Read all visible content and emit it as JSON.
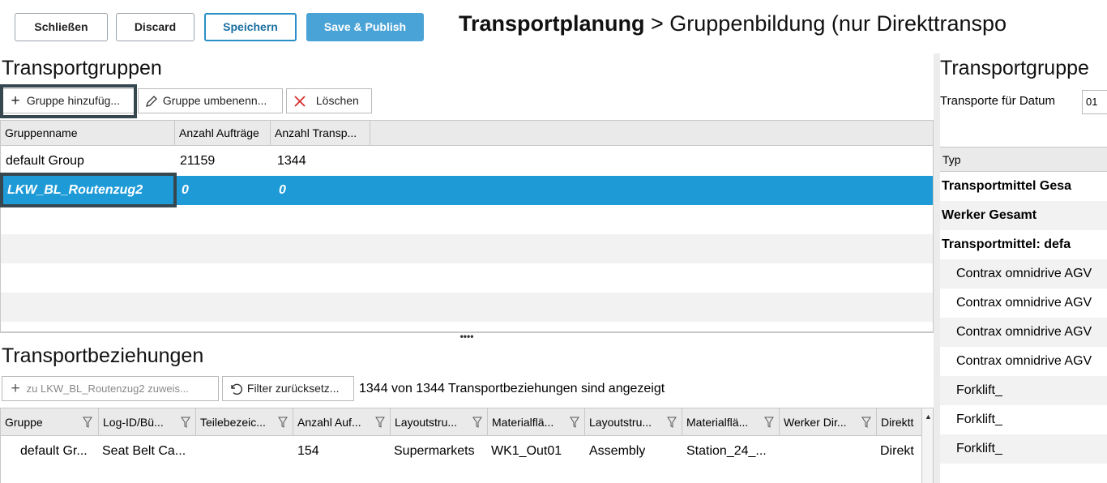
{
  "toolbar": {
    "close_label": "Schließen",
    "discard_label": "Discard",
    "save_label": "Speichern",
    "publish_label": "Save & Publish"
  },
  "page_title": {
    "part1": "Transportplanung",
    "sep": " > ",
    "part2": "Gruppenbildung (nur Direkttranspo"
  },
  "groups": {
    "title": "Transportgruppen",
    "add_label": "Gruppe hinzufüg...",
    "rename_label": "Gruppe umbenenn...",
    "delete_label": "Löschen",
    "columns": [
      "Gruppenname",
      "Anzahl Aufträge",
      "Anzahl Transp..."
    ],
    "rows": [
      {
        "name": "default Group",
        "orders": "21159",
        "transports": "1344"
      },
      {
        "name": "LKW_BL_Routenzug2",
        "orders": "0",
        "transports": "0"
      }
    ],
    "splitter_label": "••••"
  },
  "relations": {
    "title": "Transportbeziehungen",
    "assign_label": "zu LKW_BL_Routenzug2 zuweis...",
    "reset_label": "Filter zurücksetz...",
    "status_text": "1344 von 1344 Transportbeziehungen sind angezeigt",
    "columns": [
      "Gruppe",
      "Log-ID/Bü...",
      "Teilebezeic...",
      "Anzahl Auf...",
      "Layoutstru...",
      "Materialflä...",
      "Layoutstru...",
      "Materialflä...",
      "Werker Dir...",
      "Direktt"
    ],
    "rows": [
      [
        "default Gr...",
        "Seat Belt Ca...",
        "",
        "154",
        "Supermarkets",
        "WK1_Out01",
        "Assembly",
        "Station_24_...",
        "",
        "Direkt"
      ]
    ]
  },
  "right_panel": {
    "title": "Transportgruppe",
    "date_label": "Transporte für Datum",
    "date_value": "01",
    "column_label": "Typ",
    "rows": [
      {
        "label": "Transportmittel Gesa",
        "style": "bold"
      },
      {
        "label": "Werker Gesamt",
        "style": "bold"
      },
      {
        "label": "Transportmittel: defa",
        "style": "bold"
      },
      {
        "label": "Contrax omnidrive AGV",
        "style": "indent"
      },
      {
        "label": "Contrax omnidrive AGV",
        "style": "indent"
      },
      {
        "label": "Contrax omnidrive AGV",
        "style": "indent"
      },
      {
        "label": "Contrax omnidrive AGV",
        "style": "indent"
      },
      {
        "label": "Forklift_",
        "style": "indent"
      },
      {
        "label": "Forklift_",
        "style": "indent"
      },
      {
        "label": "Forklift_",
        "style": "indent"
      }
    ]
  },
  "icons": {
    "add": "plus-icon",
    "rename": "pencil-icon",
    "delete": "x-icon",
    "reset": "undo-icon",
    "filter": "filter-icon"
  },
  "colors": {
    "selection": "#1e9bd7",
    "primary": "#4aa3d6",
    "highlight_border": "#37474f",
    "delete_icon": "#d32f2f"
  }
}
